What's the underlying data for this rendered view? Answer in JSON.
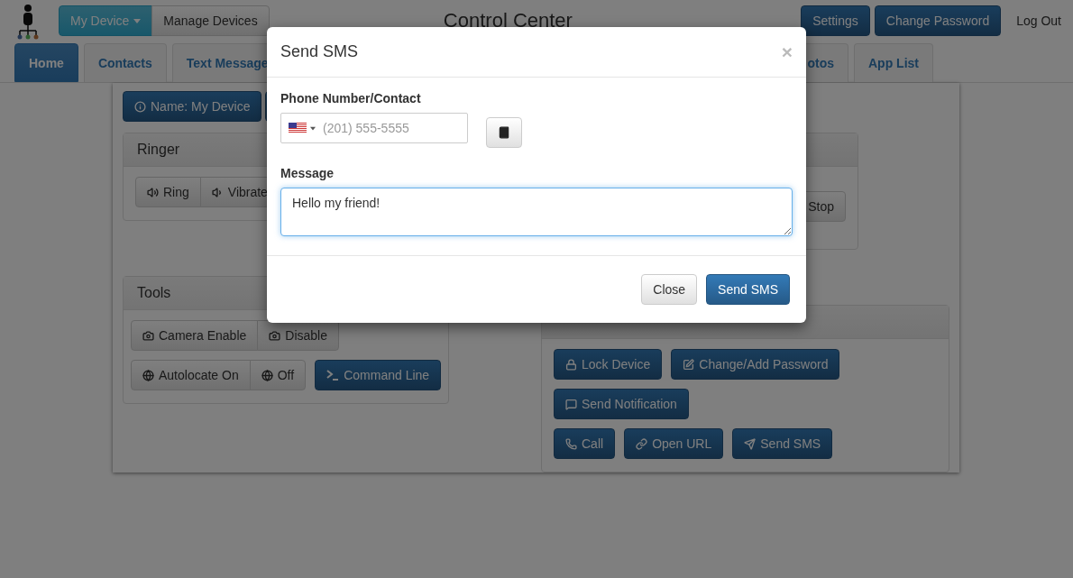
{
  "header": {
    "device_menu": {
      "label": "My Device",
      "selected": true
    },
    "manage_devices": "Manage Devices",
    "title": "Control Center",
    "buttons": [
      "Settings",
      "Change Password"
    ],
    "logout": "Log Out"
  },
  "tabs": [
    {
      "label": "Home",
      "selected": true
    },
    {
      "label": "Contacts",
      "selected": false
    },
    {
      "label": "Text Message",
      "selected": false
    },
    {
      "label": "otos",
      "selected": false
    },
    {
      "label": "App List",
      "selected": false
    }
  ],
  "device_name": "Name: My Device",
  "ringer": {
    "title": "Ringer",
    "buttons": [
      "Ring",
      "Vibrate"
    ]
  },
  "media": {
    "stop": "Stop"
  },
  "tools": {
    "title": "Tools",
    "camera": [
      "Camera Enable",
      "Disable"
    ],
    "autolocate": [
      "Autolocate On",
      "Off"
    ],
    "command": "Command Line"
  },
  "actions": {
    "rows": [
      [
        "Lock Device",
        "Change/Add Password"
      ],
      [
        "Send Notification"
      ],
      [
        "Call",
        "Open URL",
        "Send SMS"
      ]
    ]
  },
  "modal": {
    "title": "Send SMS",
    "close": "×",
    "phone_label": "Phone Number/Contact",
    "phone_placeholder": "(201) 555-5555",
    "message_label": "Message",
    "message_value": "Hello my friend!",
    "buttons": [
      {
        "label": "Close",
        "kind": "default"
      },
      {
        "label": "Send SMS",
        "kind": "primary"
      }
    ]
  }
}
